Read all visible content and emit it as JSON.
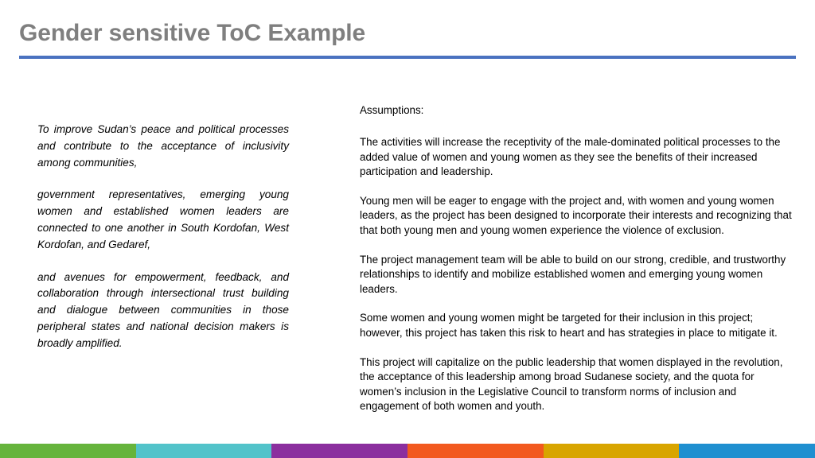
{
  "slide": {
    "title": "Gender sensitive ToC Example",
    "title_color": "#7f7f7f",
    "rule_color": "#4a72c0",
    "background_color": "#ffffff"
  },
  "left_column": {
    "paragraphs": [
      "To improve Sudan’s peace and political processes and contribute to the acceptance of inclusivity among communities,",
      "government representatives, emerging young women and established women leaders are connected to one another in South Kordofan, West Kordofan, and Gedaref,",
      "and avenues for empowerment, feedback, and collaboration through intersectional trust building and dialogue between communities in those peripheral states and national decision makers is broadly amplified."
    ]
  },
  "right_column": {
    "heading": "Assumptions:",
    "paragraphs": [
      "The activities will increase the receptivity of the male-dominated political processes to the added value of women and young women as they see the benefits of their increased participation and leadership.",
      "Young men will be eager to engage with the project and, with women and young women leaders, as the project has been designed to incorporate their interests and recognizing that that both young men and young women experience the violence of exclusion.",
      "The project management team will be able to build on our strong, credible, and trustworthy relationships to identify and mobilize established women and emerging young women leaders.",
      "Some women and young women might be targeted for their inclusion in this project; however, this project has taken this risk to heart and has strategies in place to mitigate it.",
      "This project will capitalize on the public leadership that women displayed in the revolution, the acceptance of this leadership among broad Sudanese society, and the quota for women’s inclusion in the Legislative Council to transform norms of inclusion and engagement of both women and youth."
    ]
  },
  "footer": {
    "bands": [
      {
        "name": "green",
        "color": "#66b43c"
      },
      {
        "name": "teal",
        "color": "#52c3ca"
      },
      {
        "name": "purple",
        "color": "#8b2f9e"
      },
      {
        "name": "orange",
        "color": "#f2591f"
      },
      {
        "name": "gold",
        "color": "#d8a500"
      },
      {
        "name": "blue",
        "color": "#1f8fd0"
      }
    ]
  }
}
